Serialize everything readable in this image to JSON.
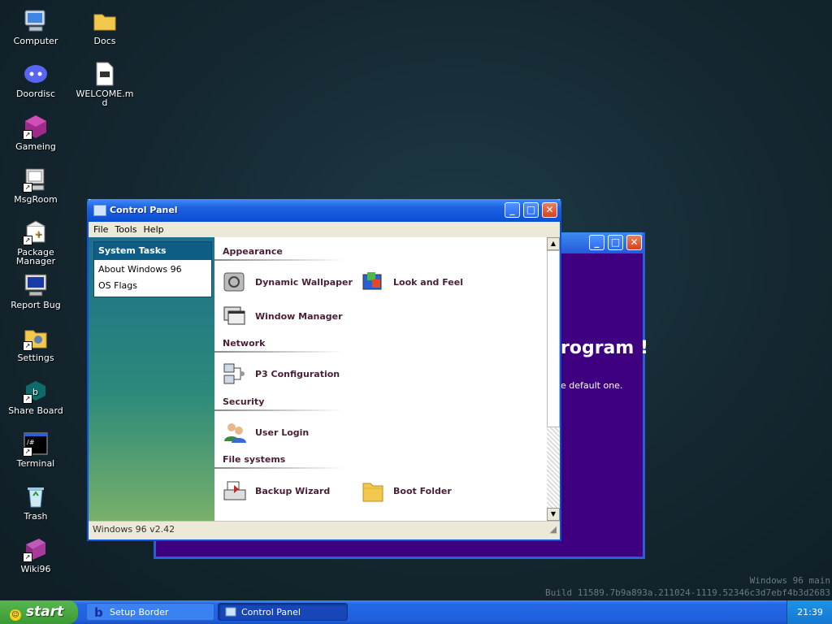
{
  "desktop": {
    "icons": [
      {
        "label": "Computer"
      },
      {
        "label": "Docs"
      },
      {
        "label": "Doordisc"
      },
      {
        "label": "WELCOME.md"
      },
      {
        "label": "Gameing"
      },
      {
        "label": "MsgRoom"
      },
      {
        "label": "Package Manager"
      },
      {
        "label": "Report Bug"
      },
      {
        "label": "Settings"
      },
      {
        "label": "Share Board"
      },
      {
        "label": "Terminal"
      },
      {
        "label": "Trash"
      },
      {
        "label": "Wiki96"
      }
    ],
    "watermark_line1": "Windows 96 main",
    "watermark_line2": "Build 11589.7b9a893a.211024-1119.52346c3d7ebf4b3d2683"
  },
  "background_window": {
    "heading_fragment": "rogram !",
    "text_fragment": "e default one.",
    "accent": "#3e0081"
  },
  "control_panel": {
    "title": "Control Panel",
    "menu": [
      "File",
      "Tools",
      "Help"
    ],
    "system_tasks": {
      "header": "System Tasks",
      "items": [
        "About Windows 96",
        "OS Flags"
      ]
    },
    "sections": {
      "appearance": "Appearance",
      "network": "Network",
      "security": "Security",
      "file_systems": "File systems"
    },
    "items": {
      "dynamic_wallpaper": "Dynamic Wallpaper",
      "look_and_feel": "Look and Feel",
      "window_manager": "Window Manager",
      "p3_configuration": "P3 Configuration",
      "user_login": "User Login",
      "backup_wizard": "Backup Wizard",
      "boot_folder": "Boot Folder"
    },
    "status": "Windows 96 v2.42"
  },
  "taskbar": {
    "start_label": "start",
    "buttons": [
      "Setup Border",
      "Control Panel"
    ],
    "clock": "21:39"
  },
  "colors": {
    "title_bar": "#0a4fd4",
    "taskbar": "#1f5fdc",
    "start_button": "#3a9a34",
    "item_text": "#4a1f36"
  }
}
